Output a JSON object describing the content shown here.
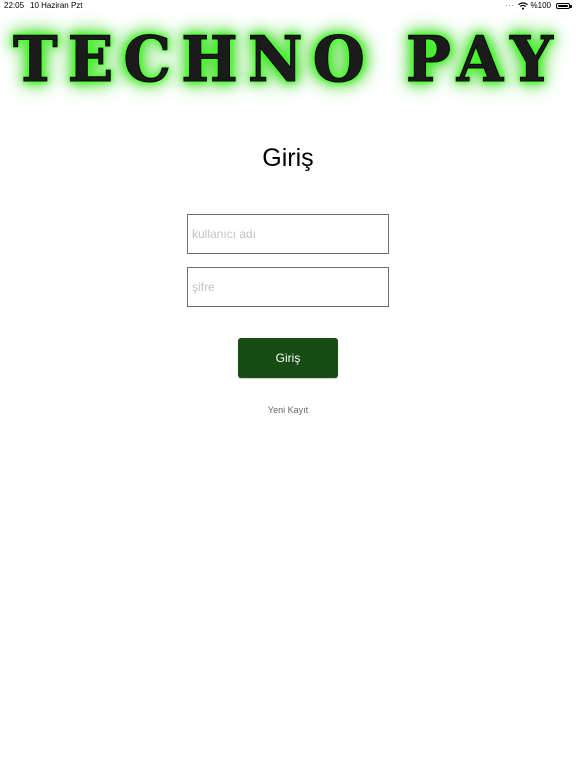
{
  "status_bar": {
    "time": "22:05",
    "date": "10 Haziran Pzt",
    "battery_text": "%100",
    "icons": [
      "wifi-icon",
      "battery-icon"
    ]
  },
  "logo": {
    "text": "TECHNO PAY",
    "glow_color": "#39ff14"
  },
  "page": {
    "title": "Giriş"
  },
  "form": {
    "username_placeholder": "kullanıcı adı",
    "username_value": "",
    "password_placeholder": "şifre",
    "password_value": "",
    "login_label": "Giriş",
    "register_label": "Yeni Kayıt"
  },
  "colors": {
    "button_background": "#174c12",
    "button_text": "#ffffff",
    "link_text": "#666666"
  }
}
